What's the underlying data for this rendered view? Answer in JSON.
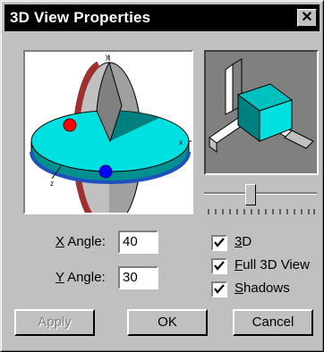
{
  "window": {
    "title": "3D View Properties",
    "close_symbol": "✕"
  },
  "preview": {
    "axis_y_label": "y",
    "axis_x_label": "x",
    "axis_z_label": "z"
  },
  "angles": {
    "x_label_accel": "X",
    "x_label_rest": " Angle:",
    "x_value": "40",
    "y_label_accel": "Y",
    "y_label_rest": " Angle:",
    "y_value": "30"
  },
  "options": {
    "threed": {
      "accel": "3",
      "rest": "D",
      "checked": true
    },
    "full3d": {
      "accel": "F",
      "rest": "ull 3D View",
      "checked": true
    },
    "shadows": {
      "accel": "S",
      "rest": "hadows",
      "checked": true
    }
  },
  "buttons": {
    "apply": "Apply",
    "ok": "OK",
    "cancel": "Cancel"
  },
  "slider": {
    "value_fraction": 0.4
  },
  "colors": {
    "cyan": "#00ffff",
    "teal": "#008080",
    "red": "#ff0000",
    "blue": "#0000ff",
    "title_bar": "#000000"
  }
}
